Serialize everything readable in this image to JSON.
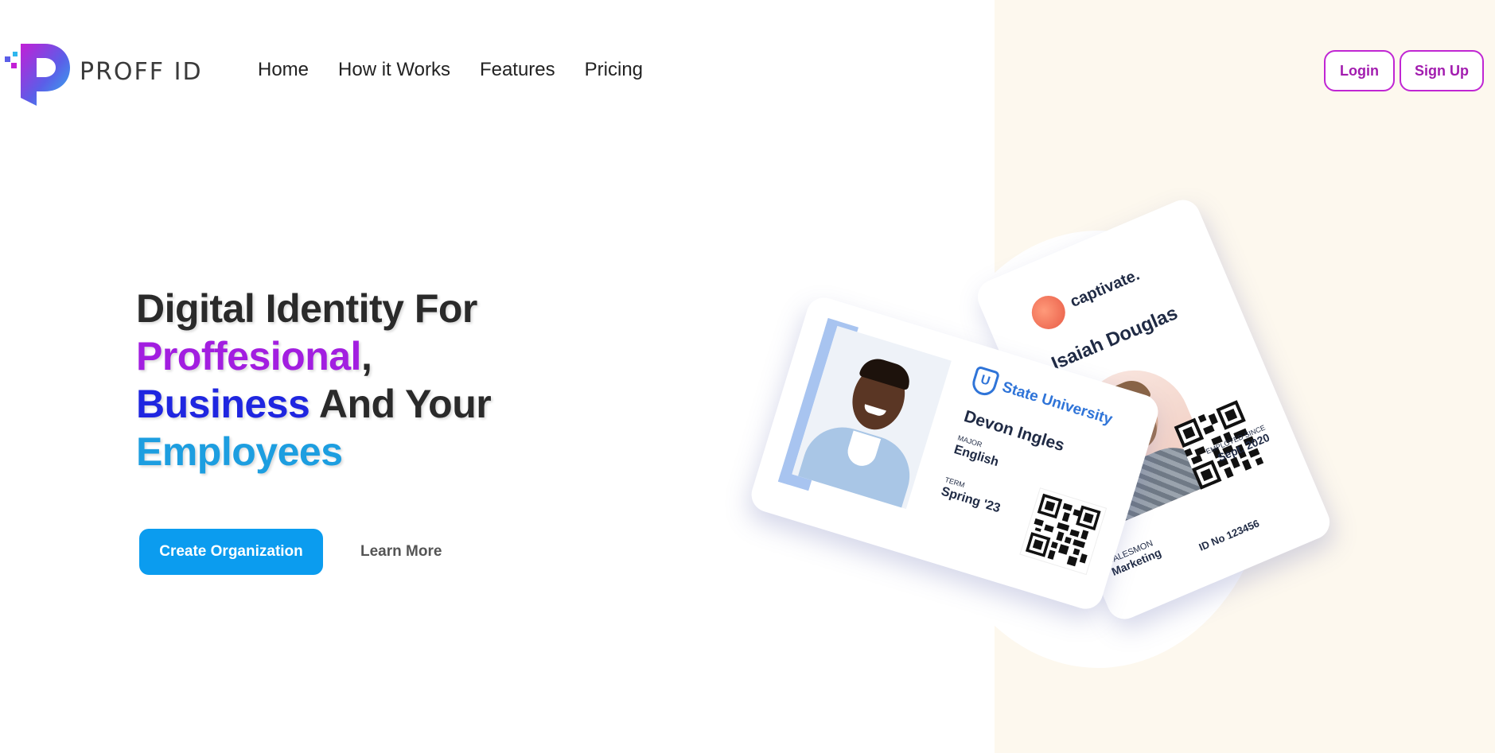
{
  "brand": {
    "name": "PROFF ID",
    "logo_icon": "proff-id-logo-icon"
  },
  "nav": {
    "items": [
      {
        "label": "Home"
      },
      {
        "label": "How it Works"
      },
      {
        "label": "Features"
      },
      {
        "label": "Pricing"
      }
    ]
  },
  "auth": {
    "login_label": "Login",
    "signup_label": "Sign Up"
  },
  "hero": {
    "line1": "Digital Identity For",
    "word_professional": "Proffesional",
    "comma": ",",
    "word_business": "Business",
    "and_your": " And Your",
    "word_employees": "Employees",
    "cta_primary": "Create Organization",
    "cta_secondary": "Learn More"
  },
  "cards": {
    "back": {
      "company": "captivate.",
      "name": "Isaiah Douglas",
      "dept_label": "SALESMON",
      "dept_value": "Marketing",
      "employed_label": "EMPLOYED SINCE",
      "employed_value": "Sept. 2020",
      "id": "ID No 123456"
    },
    "front": {
      "institution": "State University",
      "shield_letter": "U",
      "name": "Devon Ingles",
      "major_label": "MAJOR",
      "major_value": "English",
      "term_label": "TERM",
      "term_value": "Spring '23"
    }
  },
  "colors": {
    "accent_purple": "#a21ee0",
    "accent_blue": "#1f26e0",
    "accent_sky": "#1d9ee0",
    "button_primary": "#0b9cef",
    "button_outline": "#c026d3",
    "right_panel": "#fdf8ee"
  }
}
